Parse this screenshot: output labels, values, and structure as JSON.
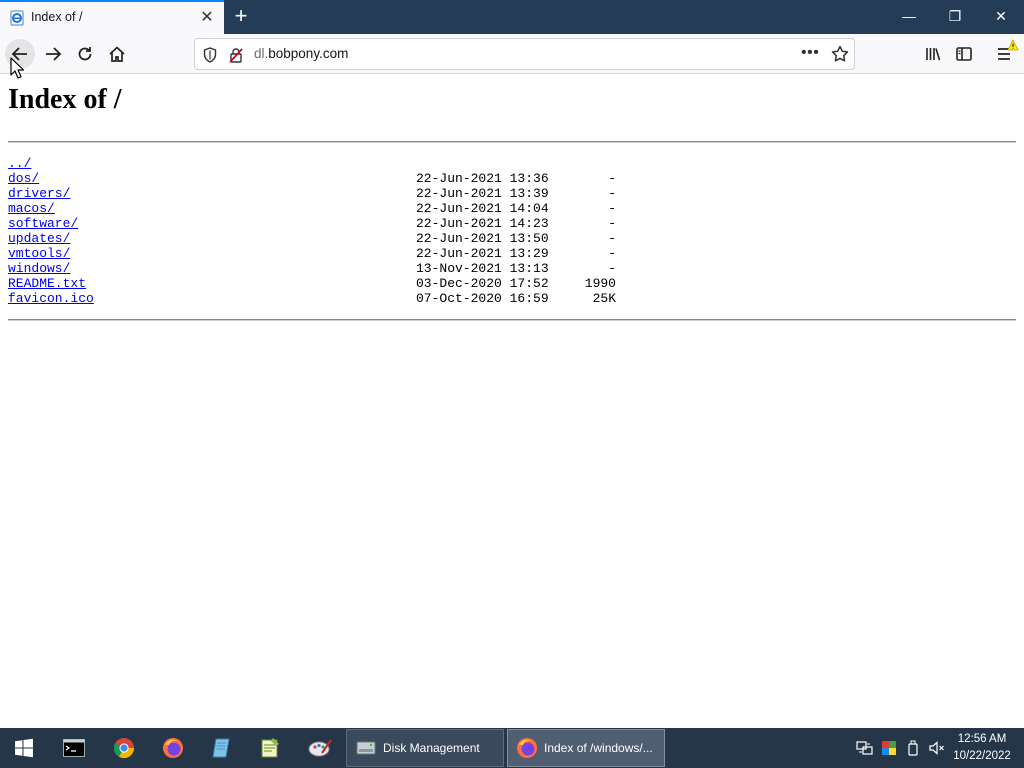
{
  "browser": {
    "tab_title": "Index of /",
    "tab_close_glyph": "✕",
    "new_tab_glyph": "+",
    "url_subdomain": "dl.",
    "url_domain": "bobpony.com",
    "url_more_glyph": "•••",
    "window_min_glyph": "—",
    "window_max_glyph": "❐",
    "window_close_glyph": "✕",
    "icons": [
      "ie-page-favicon",
      "back-arrow-icon",
      "forward-arrow-icon",
      "reload-icon",
      "home-icon",
      "shield-icon",
      "insecure-lock-icon",
      "star-icon",
      "library-icon",
      "sidebar-icon",
      "menu-icon",
      "update-warning-icon"
    ],
    "accent_color": "#0a84ff"
  },
  "page": {
    "heading": "Index of /",
    "entries": [
      {
        "name": "../",
        "date": "",
        "size": ""
      },
      {
        "name": "dos/",
        "date": "22-Jun-2021 13:36",
        "size": "-"
      },
      {
        "name": "drivers/",
        "date": "22-Jun-2021 13:39",
        "size": "-"
      },
      {
        "name": "macos/",
        "date": "22-Jun-2021 14:04",
        "size": "-"
      },
      {
        "name": "software/",
        "date": "22-Jun-2021 14:23",
        "size": "-"
      },
      {
        "name": "updates/",
        "date": "22-Jun-2021 13:50",
        "size": "-"
      },
      {
        "name": "vmtools/",
        "date": "22-Jun-2021 13:29",
        "size": "-"
      },
      {
        "name": "windows/",
        "date": "13-Nov-2021 13:13",
        "size": "-"
      },
      {
        "name": "README.txt",
        "date": "03-Dec-2020 17:52",
        "size": "1990"
      },
      {
        "name": "favicon.ico",
        "date": "07-Oct-2020 16:59",
        "size": "25K"
      }
    ],
    "link_color": "#0000ee"
  },
  "taskbar": {
    "pinned": [
      "windows-start-icon",
      "command-prompt-icon",
      "chrome-icon",
      "firefox-icon",
      "notepad-icon",
      "notepadpp-icon",
      "paint-icon"
    ],
    "tasks": [
      {
        "label": "Disk Management",
        "icon": "disk-management-icon"
      },
      {
        "label": "Index of /windows/...",
        "icon": "firefox-icon"
      }
    ],
    "tray_icons": [
      "network-icon",
      "color-icon",
      "usb-drive-icon",
      "volume-muted-icon"
    ],
    "clock_time": "12:56 AM",
    "clock_date": "10/22/2022",
    "background_color": "#253649"
  }
}
